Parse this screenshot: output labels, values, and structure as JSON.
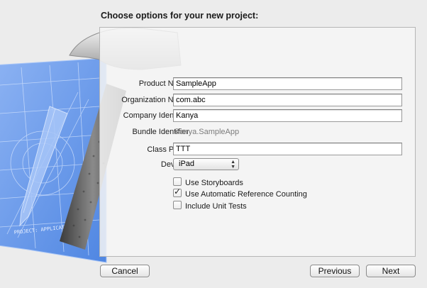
{
  "dialog": {
    "title": "Choose options for your new project:"
  },
  "form": {
    "product_name": {
      "label": "Product Name",
      "value": "SampleApp"
    },
    "organization_name": {
      "label": "Organization Name",
      "value": "com.abc"
    },
    "company_identifier": {
      "label": "Company Identifier",
      "value": "Kanya"
    },
    "bundle_identifier": {
      "label": "Bundle Identifier",
      "value": "Kanya.SampleApp"
    },
    "class_prefix": {
      "label": "Class Prefix",
      "value": "TTT"
    },
    "devices": {
      "label": "Devices",
      "selected": "iPad"
    },
    "options": [
      {
        "label": "Use Storyboards",
        "checked": false
      },
      {
        "label": "Use Automatic Reference Counting",
        "checked": true
      },
      {
        "label": "Include Unit Tests",
        "checked": false
      }
    ]
  },
  "buttons": {
    "cancel": "Cancel",
    "previous": "Previous",
    "next": "Next"
  },
  "artwork": {
    "blueprint_text": "PROJECT: APPLICATION.APP",
    "icon": "xcode-hammer-blueprint-icon",
    "blueprint_color": "#5b8fe6"
  }
}
